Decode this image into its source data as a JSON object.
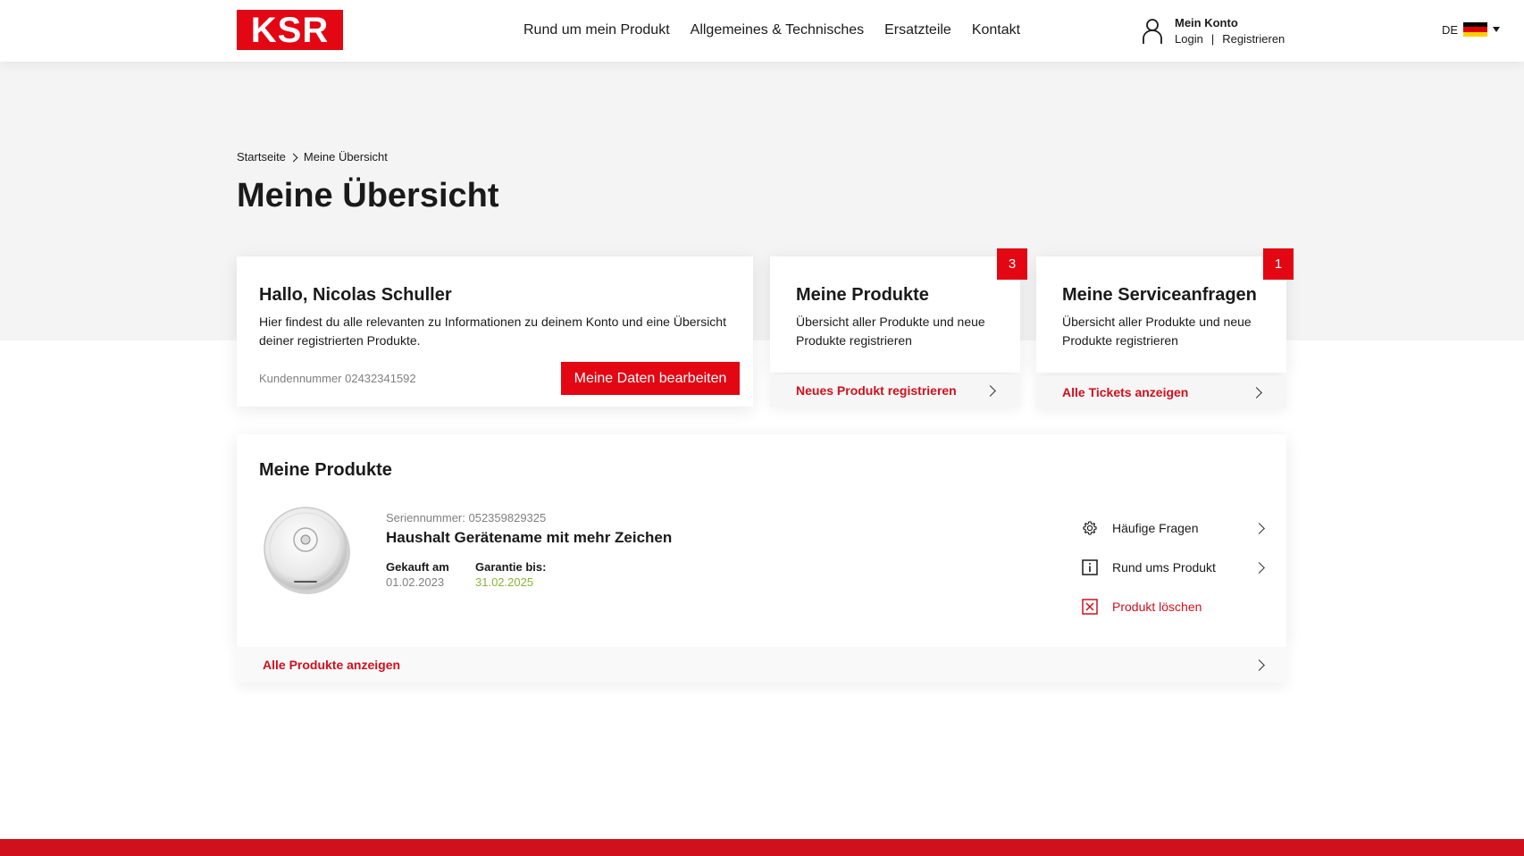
{
  "brand": {
    "logo_text": "KSR",
    "accent_color": "#e30613"
  },
  "nav": {
    "items": [
      {
        "label": "Rund um mein Produkt"
      },
      {
        "label": "Allgemeines & Technisches"
      },
      {
        "label": "Ersatzteile"
      },
      {
        "label": "Kontakt"
      }
    ]
  },
  "account": {
    "title": "Mein Konto",
    "login": "Login",
    "separator": "|",
    "register": "Registrieren",
    "icon": "user-icon"
  },
  "language": {
    "code": "DE",
    "flag": "flag-germany-icon"
  },
  "breadcrumb": {
    "home": "Startseite",
    "current": "Meine Übersicht"
  },
  "page_title": "Meine Übersicht",
  "welcome_card": {
    "title": "Hallo, Nicolas Schuller",
    "description": "Hier findest du alle relevanten zu Informationen zu deinem Konto und eine Übersicht deiner registrierten Produkte.",
    "customer_number": "Kundennummer 02432341592",
    "edit_button": "Meine Daten bearbeiten"
  },
  "products_card": {
    "badge": "3",
    "title": "Meine Produkte",
    "description": "Übersicht aller Produkte und neue Produkte registrieren",
    "footer_link": "Neues Produkt registrieren"
  },
  "service_card": {
    "badge": "1",
    "title": "Meine Serviceanfragen",
    "description": "Übersicht aller Produkte und neue Produkte registrieren",
    "footer_link": "Alle Tickets anzeigen"
  },
  "my_products": {
    "title": "Meine Produkte",
    "product": {
      "serial": "Seriennummer: 052359829325",
      "name": "Haushalt Gerätename mit mehr Zeichen",
      "purchased_label": "Gekauft am",
      "purchased_value": "01.02.2023",
      "warranty_label": "Garantie bis:",
      "warranty_value": "31.02.2025",
      "warranty_color": "#8bb33a"
    },
    "actions": [
      {
        "label": "Häufige Fragen",
        "icon": "gear-icon"
      },
      {
        "label": "Rund ums Produkt",
        "icon": "info-icon"
      },
      {
        "label": "Produkt löschen",
        "icon": "delete-icon"
      }
    ],
    "footer_link": "Alle Produkte anzeigen"
  }
}
